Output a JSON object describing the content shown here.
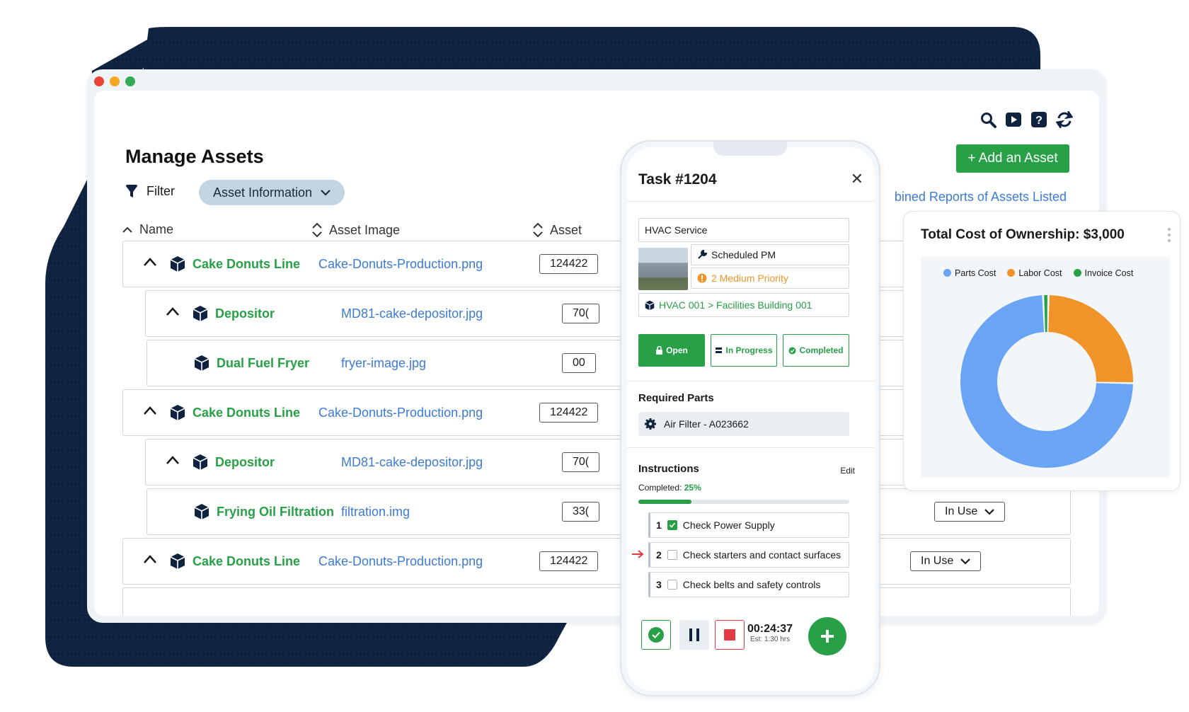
{
  "window": {
    "title": "Manage Assets",
    "add_button": "+ Add an Asset",
    "reports_link": "bined Reports of Assets Listed",
    "filter_label": "Filter",
    "filter_chip": "Asset Information",
    "columns": [
      "Name",
      "Asset Image",
      "Asset"
    ],
    "rows": [
      {
        "name": "Cake Donuts Line",
        "image": "Cake-Donuts-Production.png",
        "id": "124422"
      },
      {
        "name": "Depositor",
        "image": "MD81-cake-depositor.jpg",
        "id": "70("
      },
      {
        "name": "Dual Fuel Fryer",
        "image": "fryer-image.jpg",
        "id": "00"
      },
      {
        "name": "Cake Donuts Line",
        "image": "Cake-Donuts-Production.png",
        "id": "124422"
      },
      {
        "name": "Depositor",
        "image": "MD81-cake-depositor.jpg",
        "id": "70("
      },
      {
        "name": "Frying Oil Filtration",
        "image": "filtration.img",
        "id": "33("
      },
      {
        "name": "Cake Donuts Line",
        "image": "Cake-Donuts-Production.png",
        "id": "124422"
      }
    ],
    "status_in_use": "In Use",
    "colors": {
      "accent": "#27a047",
      "link": "#3c7bd4",
      "backdrop": "#0f2340"
    }
  },
  "phone": {
    "task_title": "Task #1204",
    "service": "HVAC Service",
    "type": "Scheduled PM",
    "priority": "2 Medium Priority",
    "location": "HVAC 001 > Facilities Building 001",
    "status_open": "Open",
    "status_in_progress": "In Progress",
    "status_completed": "Completed",
    "required_parts_title": "Required Parts",
    "part": "Air Filter - A023662",
    "instructions_title": "Instructions",
    "edit": "Edit",
    "completed_label": "Completed:",
    "completed_value": "25%",
    "progress": 0.25,
    "steps": [
      {
        "num": "1",
        "label": "Check Power Supply",
        "checked": true
      },
      {
        "num": "2",
        "label": "Check starters and contact surfaces",
        "checked": false
      },
      {
        "num": "3",
        "label": "Check belts and safety controls",
        "checked": false
      }
    ],
    "timer": "00:24:37",
    "estimate": "Est: 1:30 hrs"
  },
  "cost_card": {
    "title": "Total Cost of Ownership: $3,000",
    "legend": [
      "Parts Cost",
      "Labor Cost",
      "Invoice Cost"
    ]
  },
  "chart_data": {
    "type": "pie",
    "categories": [
      "Parts Cost",
      "Labor Cost",
      "Invoice Cost"
    ],
    "values": [
      74,
      25,
      1
    ],
    "colors": [
      "#6aa5f5",
      "#f0942a",
      "#27a047"
    ]
  }
}
